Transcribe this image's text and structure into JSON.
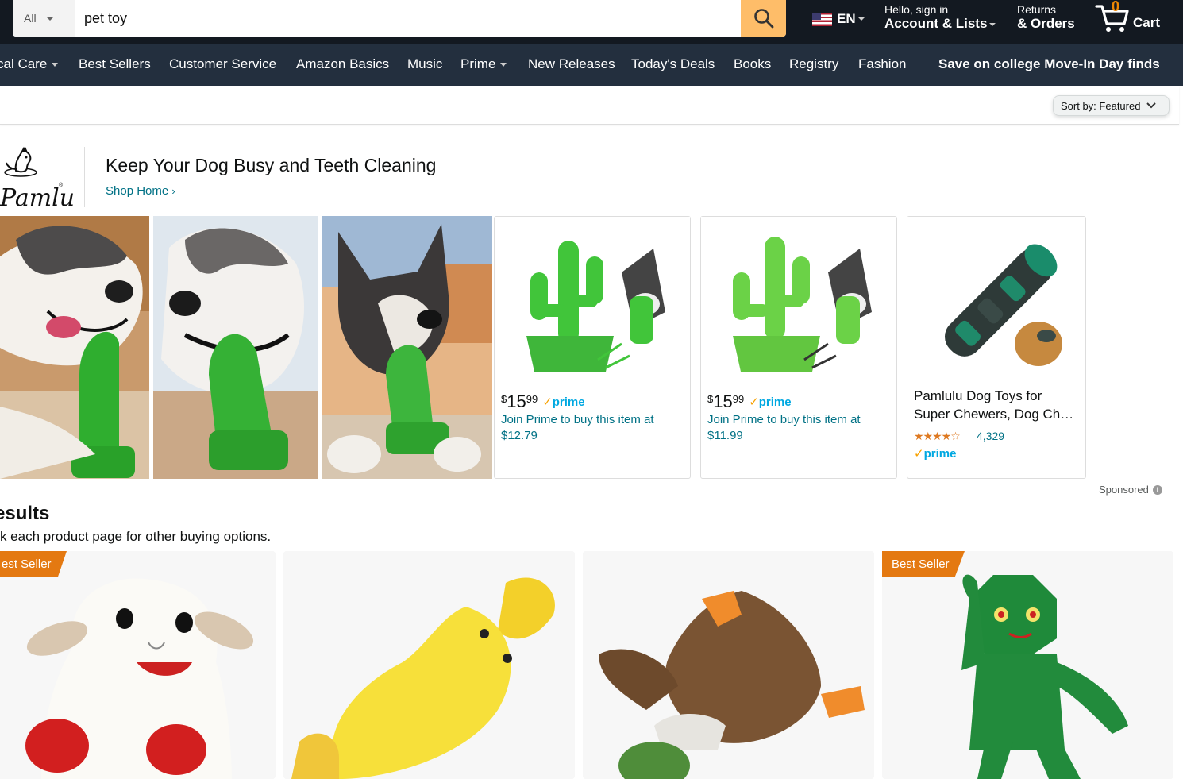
{
  "header": {
    "search_dept": "All",
    "search_value": "pet toy",
    "language": "EN",
    "account_line1": "Hello, sign in",
    "account_line2": "Account & Lists",
    "orders_line1": "Returns",
    "orders_line2": "& Orders",
    "cart_count": "0",
    "cart_label": "Cart"
  },
  "nav": {
    "items": [
      "cal Care",
      "Best Sellers",
      "Customer Service",
      "Amazon Basics",
      "Music",
      "Prime",
      "New Releases",
      "Today's Deals",
      "Books",
      "Registry",
      "Fashion"
    ],
    "promo": "Save on college Move-In Day finds"
  },
  "sort": {
    "label": "Sort by:",
    "value": "Featured"
  },
  "brand": {
    "logo_text": "Pamlulu",
    "headline": "Keep Your Dog Busy and Teeth Cleaning",
    "shop_home": "Shop Home"
  },
  "sponsored_products": [
    {
      "price_symbol": "$",
      "price_whole": "15",
      "price_cents": "99",
      "prime": "prime",
      "join_text": "Join Prime to buy this item at $12.79"
    },
    {
      "price_symbol": "$",
      "price_whole": "15",
      "price_cents": "99",
      "prime": "prime",
      "join_text": "Join Prime to buy this item at $11.99"
    },
    {
      "title": "Pamlulu Dog Toys for Super Chewers, Dog Ch…",
      "rating": 4.5,
      "rating_count": "4,329",
      "prime": "prime"
    }
  ],
  "sponsored_label": "Sponsored",
  "results": {
    "title": "esults",
    "subtitle": "eck each product page for other buying options.",
    "badges": [
      "est Seller",
      "Best Seller"
    ]
  },
  "colors": {
    "header_bg": "#131921",
    "nav_bg": "#232f3e",
    "search_button": "#febd69",
    "link": "#007185",
    "badge": "#e47911",
    "prime_blue": "#00a8e1"
  }
}
